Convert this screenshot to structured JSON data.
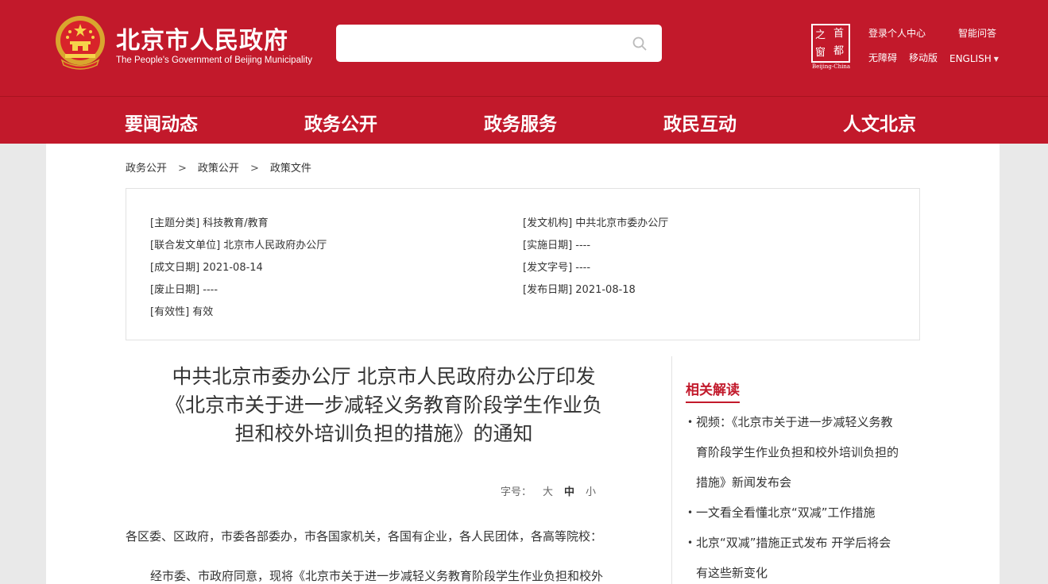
{
  "header": {
    "title": "北京市人民政府",
    "subtitle": "The People's Government of Beijing Municipality",
    "search": {
      "placeholder": "",
      "value": ""
    },
    "logo_chars": [
      "之",
      "首",
      "窗",
      "都"
    ],
    "logo_caption": "Beijing-China",
    "links": {
      "login": "登录个人中心",
      "smart_qa": "智能问答",
      "accessible": "无障碍",
      "mobile": "移动版",
      "english": "ENGLISH"
    },
    "icons": {
      "search": "search-icon",
      "emblem": "national-emblem-icon",
      "dropdown": "caret-down-icon"
    },
    "colors": {
      "brand_red": "#c2192b"
    }
  },
  "nav": {
    "items": [
      "要闻动态",
      "政务公开",
      "政务服务",
      "政民互动",
      "人文北京"
    ]
  },
  "breadcrumb": {
    "items": [
      "政务公开",
      "政策文件",
      "政策文件"
    ],
    "items_fixed": [
      "政务公开",
      "政策公开",
      "政策文件"
    ],
    "separator": ">"
  },
  "meta": {
    "topic": "[主题分类] 科技教育/教育",
    "issuer": "[发文机构] 中共北京市委办公厅",
    "joint": "[联合发文单位] 北京市人民政府办公厅",
    "effective": "[实施日期] ----",
    "created": "[成文日期] 2021-08-14",
    "doc_no": "[发文字号] ----",
    "expired": "[废止日期] ----",
    "published": "[发布日期] 2021-08-18",
    "validity": "[有效性] 有效"
  },
  "article": {
    "title_lines": [
      "中共北京市委办公厅 北京市人民政府办公厅印发",
      "《北京市关于进一步减轻义务教育阶段学生作业负",
      "担和校外培训负担的措施》的通知"
    ],
    "font_size": {
      "label": "字号：",
      "large": "大",
      "medium": "中",
      "small": "小"
    },
    "salutation": "各区委、区政府，市委各部委办，市各国家机关，各国有企业，各人民团体，各高等院校：",
    "body_start": "经市委、市政府同意，现将《北京市关于进一步减轻义务教育阶段学生作业负担和校外"
  },
  "related": {
    "title": "相关解读",
    "items": [
      [
        "视频：《北京市关于进一步减轻义务教",
        "育阶段学生作业负担和校外培训负担的",
        "措施》新闻发布会"
      ],
      [
        "一文看全看懂北京“双减”工作措施"
      ],
      [
        "北京“双减”措施正式发布 开学后将会",
        "有这些新变化"
      ]
    ]
  }
}
